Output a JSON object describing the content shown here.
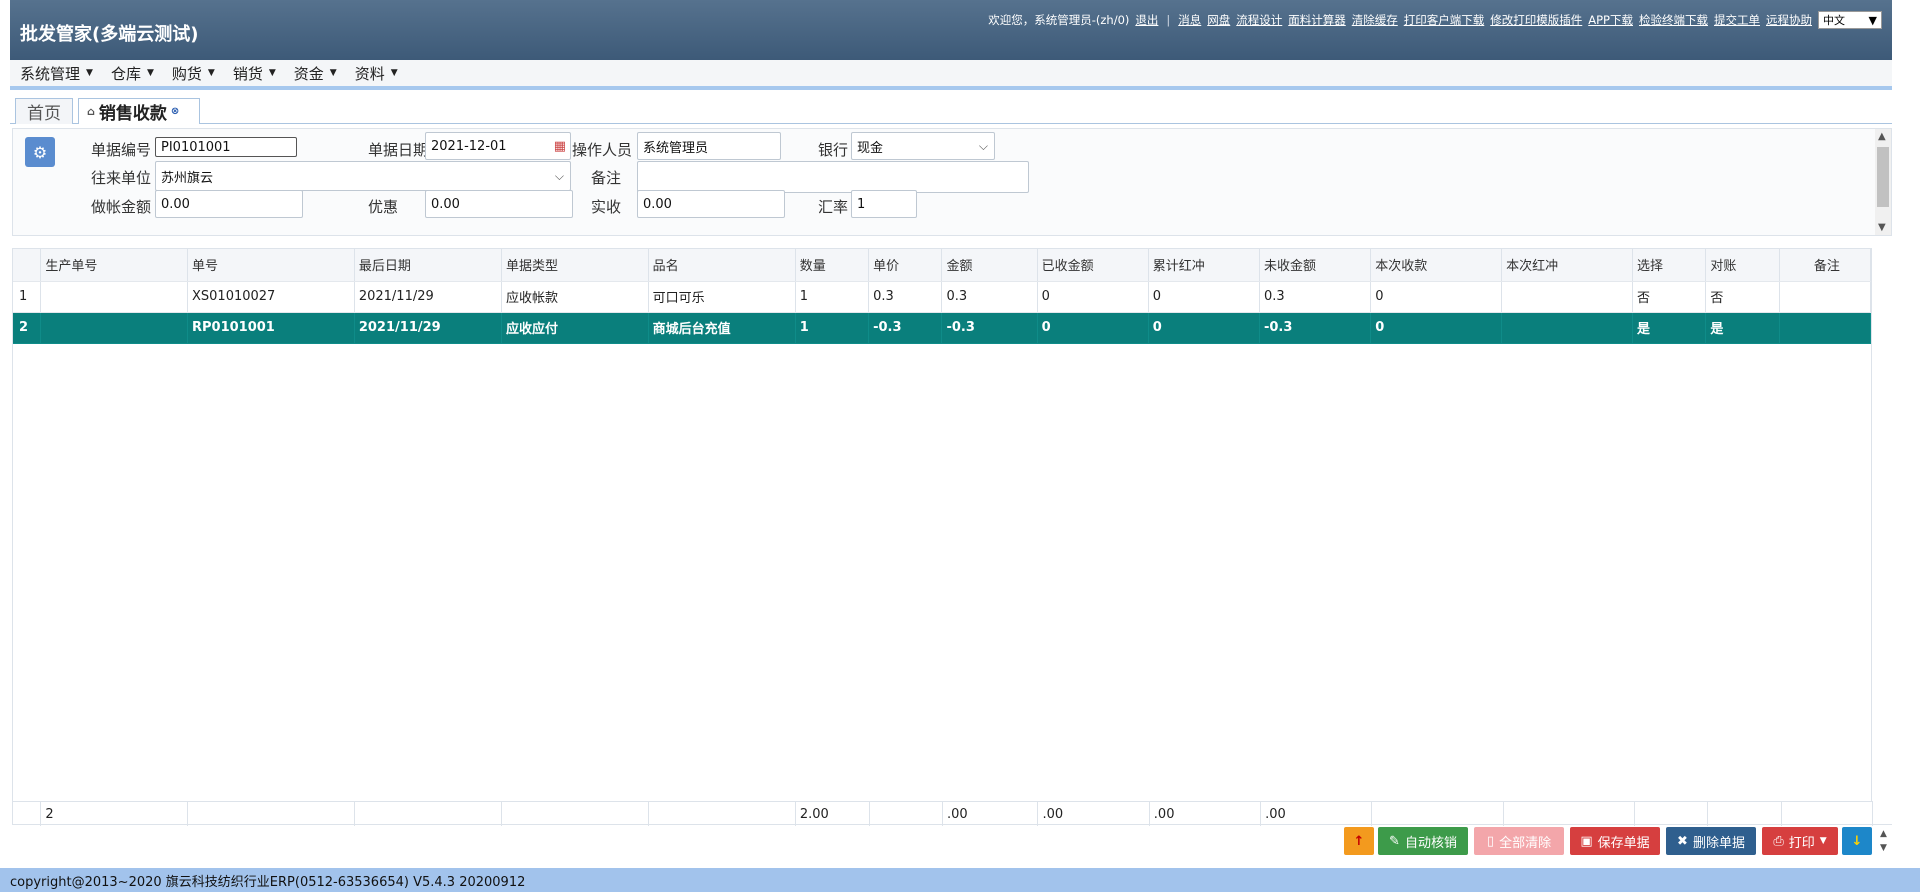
{
  "header": {
    "app_title": "批发管家(多端云测试)",
    "welcome": "欢迎您，系统管理员-(zh/0)",
    "logout": "退出",
    "links": [
      "消息",
      "网盘",
      "流程设计",
      "面料计算器",
      "清除缓存",
      "打印客户端下载",
      "修改打印模版插件",
      "APP下载",
      "检验终端下载",
      "提交工单",
      "远程协助"
    ],
    "language": "中文"
  },
  "menu": {
    "items": [
      "系统管理",
      "仓库",
      "购货",
      "销货",
      "资金",
      "资料"
    ]
  },
  "tabs": {
    "home": "首页",
    "active": "销售收款"
  },
  "form": {
    "doc_no_label": "单据编号",
    "doc_no": "PI0101001",
    "doc_date_label": "单据日期",
    "doc_date": "2021-12-01",
    "operator_label": "操作人员",
    "operator": "系统管理员",
    "bank_label": "银行",
    "bank": "现金",
    "partner_label": "往来单位",
    "partner": "苏州旗云",
    "remark_label": "备注",
    "remark": "",
    "book_amount_label": "做帐金额",
    "book_amount": "0.00",
    "discount_label": "优惠",
    "discount": "0.00",
    "received_label": "实收",
    "received": "0.00",
    "rate_label": "汇率",
    "rate": "1"
  },
  "grid": {
    "columns": [
      "",
      "生产单号",
      "单号",
      "最后日期",
      "单据类型",
      "品名",
      "数量",
      "单价",
      "金额",
      "已收金额",
      "累计红冲",
      "未收金额",
      "本次收款",
      "本次红冲",
      "选择",
      "对账",
      "备注"
    ],
    "rows": [
      [
        "1",
        "",
        "XS01010027",
        "2021/11/29",
        "应收帐款",
        "可口可乐",
        "1",
        "0.3",
        "0.3",
        "0",
        "0",
        "0.3",
        "0",
        "",
        "否",
        "否",
        ""
      ],
      [
        "2",
        "",
        "RP0101001",
        "2021/11/29",
        "应收应付",
        "商城后台充值",
        "1",
        "-0.3",
        "-0.3",
        "0",
        "0",
        "-0.3",
        "0",
        "",
        "是",
        "是",
        ""
      ]
    ],
    "footer": [
      "",
      "2",
      "",
      "",
      "",
      "",
      "2.00",
      "",
      ".00",
      ".00",
      ".00",
      ".00",
      "",
      "",
      "",
      "",
      ""
    ]
  },
  "actions": {
    "auto": "自动核销",
    "clear": "全部清除",
    "save": "保存单据",
    "delete": "删除单据",
    "print": "打印"
  },
  "footer": {
    "copyright": "copyright@2013~2020 旗云科技纺织行业ERP(0512-63536654) V5.4.3 20200912"
  },
  "colors": {
    "header": "#4a6683",
    "selected_row": "#0a7f7c",
    "footer_bar": "#a2c3ec"
  }
}
